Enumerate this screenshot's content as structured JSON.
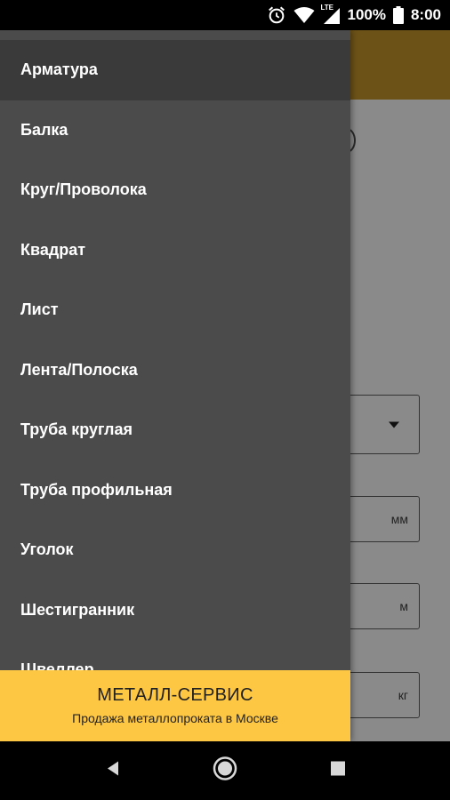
{
  "status_bar": {
    "network_label": "LTE",
    "battery": "100%",
    "time": "8:00",
    "icons": [
      "alarm-icon",
      "wifi-icon",
      "signal-icon",
      "battery-icon"
    ]
  },
  "background_form": {
    "units": {
      "diameter": "мм",
      "length": "м",
      "weight": "кг"
    }
  },
  "drawer": {
    "items": [
      {
        "label": "Арматура",
        "active": true
      },
      {
        "label": "Балка"
      },
      {
        "label": "Круг/Проволока"
      },
      {
        "label": "Квадрат"
      },
      {
        "label": "Лист"
      },
      {
        "label": "Лента/Полоска"
      },
      {
        "label": "Труба круглая"
      },
      {
        "label": "Труба профильная"
      },
      {
        "label": "Уголок"
      },
      {
        "label": "Шестигранник"
      },
      {
        "label": "Швеллер"
      }
    ],
    "footer": {
      "title": "МЕТАЛЛ-СЕРВИС",
      "subtitle": "Продажа металлопроката в Москве"
    }
  },
  "nav_bar": {
    "buttons": [
      "back-icon",
      "home-icon",
      "recents-icon"
    ]
  },
  "colors": {
    "drawer_bg": "#4b4b4b",
    "active_item_bg": "#3a3a3a",
    "footer_accent": "#fdc643",
    "toolbar_brown": "#6d5217"
  }
}
